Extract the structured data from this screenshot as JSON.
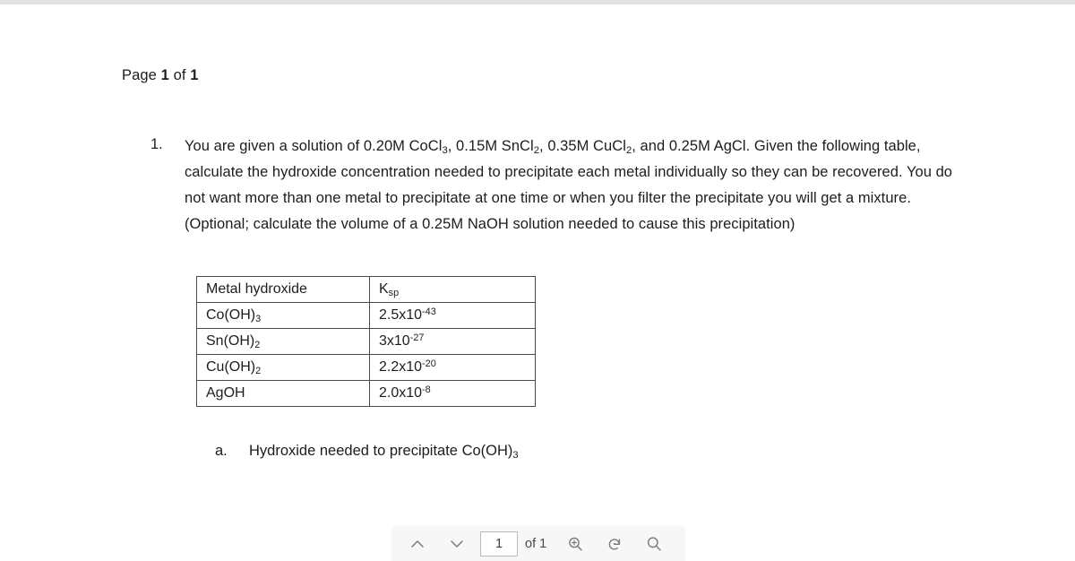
{
  "viewer": {
    "page_label_prefix": "Page",
    "page_label_current": "1",
    "page_label_middle": "of",
    "page_label_total": "1"
  },
  "question": {
    "marker": "1.",
    "line1_a": "You are given a solution of 0.20M CoCl",
    "line1_sub1": "3",
    "line1_b": ", 0.15M SnCl",
    "line1_sub2": "2",
    "line1_c": ", 0.35M CuCl",
    "line1_sub3": "2",
    "line1_d": ", and 0.25M AgCl. Given the following table, calculate the hydroxide concentration needed to precipitate each metal individually so they can be recovered. You do not want more than one metal to precipitate at one time or when you filter the precipitate you will get a mixture. (Optional; calculate the volume of a 0.25M NaOH solution needed to cause this precipitation)"
  },
  "table": {
    "headers": [
      "Metal hydroxide",
      "Ksp"
    ],
    "header_col2_base": "K",
    "header_col2_sub": "sp",
    "rows": [
      {
        "name_base": "Co(OH)",
        "name_sub": "3",
        "ksp_mantissa": "2.5x10",
        "ksp_exponent": "-43"
      },
      {
        "name_base": "Sn(OH)",
        "name_sub": "2",
        "ksp_mantissa": "3x10",
        "ksp_exponent": "-27"
      },
      {
        "name_base": "Cu(OH)",
        "name_sub": "2",
        "ksp_mantissa": "2.2x10",
        "ksp_exponent": "-20"
      },
      {
        "name_base": "AgOH",
        "name_sub": "",
        "ksp_mantissa": "2.0x10",
        "ksp_exponent": "-8"
      }
    ]
  },
  "subquestion": {
    "marker": "a.",
    "text_base": "Hydroxide needed to precipitate Co(OH)",
    "text_sub": "3"
  },
  "toolbar": {
    "previous_page_label": "chevron-up",
    "next_page_label": "chevron-down",
    "page_value": "1",
    "page_total_text": "of 1",
    "zoom_in_label": "zoom-in",
    "rotate_label": "rotate",
    "search_label": "search"
  },
  "colors": {
    "text": "#1d1d1d",
    "table_border": "#4a4a4a",
    "toolbar_bg": "#f7f7f7",
    "icon": "#6e6e6e",
    "top_strip": "#e3e3e3"
  }
}
